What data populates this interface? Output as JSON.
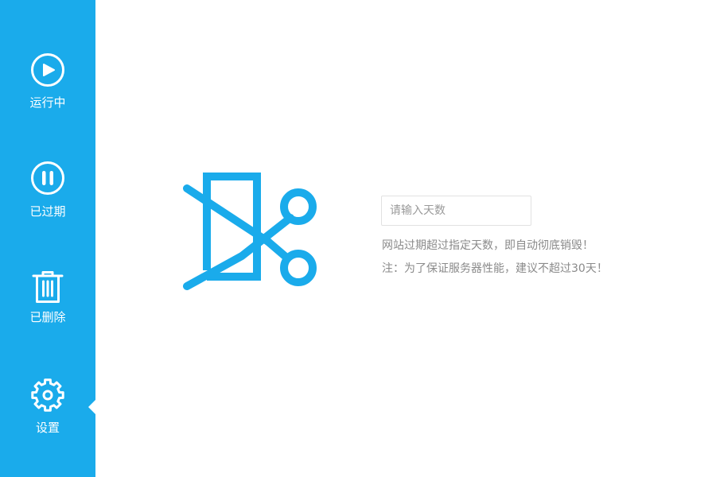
{
  "sidebar": {
    "background": "#1aabeb",
    "active": "settings",
    "items": [
      {
        "id": "running",
        "icon": "play-circle-icon",
        "label": "运行中"
      },
      {
        "id": "expired",
        "icon": "pause-circle-icon",
        "label": "已过期"
      },
      {
        "id": "deleted",
        "icon": "trash-icon",
        "label": "已删除"
      },
      {
        "id": "settings",
        "icon": "gear-icon",
        "label": "设置"
      }
    ]
  },
  "main": {
    "illustration_icon": "expired-cut-icon",
    "accent": "#1aabeb",
    "days_input": {
      "value": "",
      "placeholder": "请输入天数"
    },
    "hint_line_1": "网站过期超过指定天数，即自动彻底销毁！",
    "hint_line_2": "注：为了保证服务器性能，建议不超过30天！"
  }
}
